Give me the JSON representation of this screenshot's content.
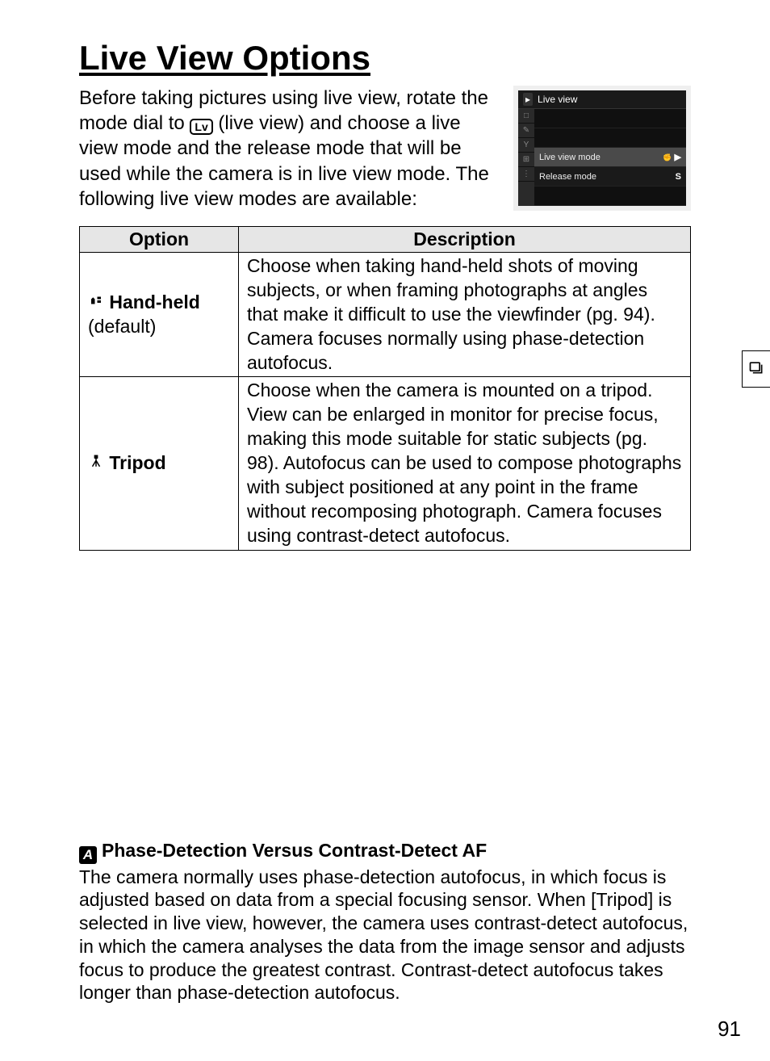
{
  "heading": "Live View Options",
  "intro_before": "Before taking pictures using live view, rotate the mode dial to ",
  "intro_lv": "Lv",
  "intro_after": " (live view) and choose a live view mode and the release mode that will be used while the camera is in live view mode.  The following live view modes are available:",
  "screenshot": {
    "title": "Live view",
    "rows": [
      {
        "label": "Live view mode",
        "value": "▶",
        "selected": true,
        "icon": "hand"
      },
      {
        "label": "Release mode",
        "value": "S",
        "selected": false,
        "icon": ""
      }
    ]
  },
  "table": {
    "headers": {
      "option": "Option",
      "description": "Description"
    },
    "rows": [
      {
        "icon": "hand-held-icon",
        "name_bold": "Hand-held",
        "name_sub": "(default)",
        "desc": "Choose when taking hand-held shots of moving subjects, or when framing photographs at angles that make it difficult to use the viewfinder (pg. 94).  Camera focuses normally using phase-detection autofocus."
      },
      {
        "icon": "tripod-icon",
        "name_bold": "Tripod",
        "name_sub": "",
        "desc": "Choose when the camera is mounted on a tripod.  View can be enlarged in monitor for precise focus, making this mode suitable for static subjects (pg. 98).  Autofocus can be used to compose photographs with subject positioned at any point in the frame without recomposing photograph.  Camera focuses using contrast-detect autofocus."
      }
    ]
  },
  "note": {
    "title": "Phase-Detection Versus Contrast-Detect AF",
    "body": "The camera normally uses phase-detection autofocus, in which focus is adjusted based on data from a special focusing sensor. When [Tripod] is selected in live view, however, the camera uses contrast-detect autofocus, in which the camera analyses the data from the image sensor and adjusts focus to produce the greatest contrast. Contrast-detect autofocus takes longer than phase-detection autofocus."
  },
  "page_number": "91"
}
